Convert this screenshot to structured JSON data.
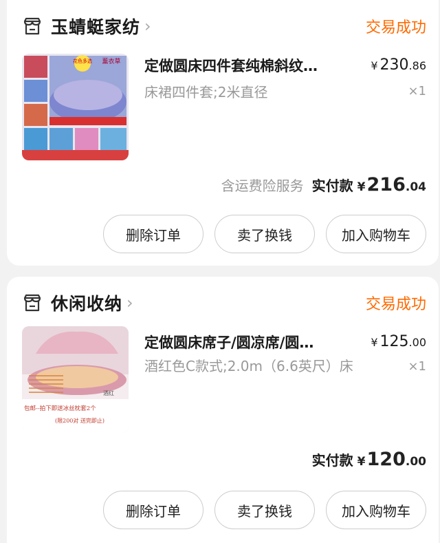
{
  "orders": [
    {
      "shop_name": "玉蜻蜓家纺",
      "status": "交易成功",
      "title": "定做圆床四件套纯棉斜纹…",
      "spec": "床裙四件套;2米直径",
      "price_currency": "¥",
      "price_int": "230",
      "price_dec": ".86",
      "qty": "×1",
      "pay_note": "含运费险服务",
      "pay_label": "实付款",
      "pay_currency": "¥",
      "pay_int": "216",
      "pay_dec": ".04",
      "image_text": {
        "badge": "花色多选",
        "tag": "薰衣草"
      },
      "buttons": {
        "delete": "删除订单",
        "sell": "卖了换钱",
        "cart": "加入购物车"
      }
    },
    {
      "shop_name": "休闲收纳",
      "status": "交易成功",
      "title": "定做圆床席子/圆凉席/圆…",
      "spec": "酒红色C款式;2.0m（6.6英尺）床",
      "price_currency": "¥",
      "price_int": "125",
      "price_dec": ".00",
      "qty": "×1",
      "pay_label": "实付款",
      "pay_currency": "¥",
      "pay_int": "120",
      "pay_dec": ".00",
      "image_text": {
        "line1": "包邮--拍下即送冰丝枕套2个",
        "line2": "(限200对  送完即止)",
        "tag": "酒红"
      },
      "buttons": {
        "delete": "删除订单",
        "sell": "卖了换钱",
        "cart": "加入购物车"
      }
    }
  ],
  "colors": {
    "status": "#ff6a00",
    "bg": "#f2f2f2"
  }
}
